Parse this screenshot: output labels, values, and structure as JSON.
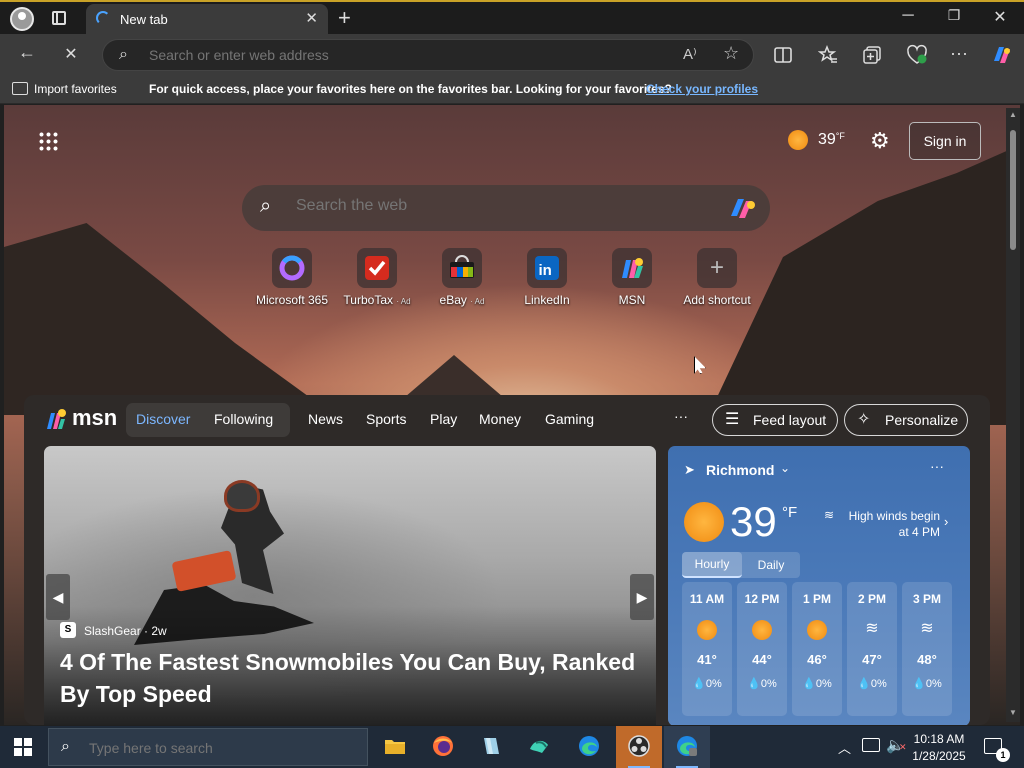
{
  "tabbar": {
    "tab_title": "New tab",
    "close_glyph": "✕",
    "new_tab_glyph": "+",
    "minimize_glyph": "─",
    "maximize_glyph": "❐",
    "close_window_glyph": "✕"
  },
  "navbar": {
    "back_glyph": "←",
    "stop_glyph": "✕",
    "address_placeholder": "Search or enter web address",
    "read_aloud_glyph": "A⁾",
    "favorite_glyph": "☆",
    "toolbar_icons": [
      "split-screen-icon",
      "favorites-icon",
      "collections-icon",
      "browser-essentials-icon",
      "more-icon",
      "copilot-icon"
    ]
  },
  "favbar": {
    "import_label": "Import favorites",
    "message": "For quick access, place your favorites here on the favorites bar. Looking for your favorites?",
    "link": "Check your profiles"
  },
  "newtab": {
    "weather_temp": "39",
    "weather_unit": "°F",
    "sign_in": "Sign in",
    "search_placeholder": "Search the web",
    "shortcuts": [
      {
        "label": "Microsoft 365",
        "ad": ""
      },
      {
        "label": "TurboTax",
        "ad": "· Ad"
      },
      {
        "label": "eBay",
        "ad": "· Ad"
      },
      {
        "label": "LinkedIn",
        "ad": ""
      },
      {
        "label": "MSN",
        "ad": ""
      },
      {
        "label": "Add shortcut",
        "ad": ""
      }
    ]
  },
  "msn": {
    "logo": "msn",
    "tabs": [
      "Discover",
      "Following"
    ],
    "nav": [
      "News",
      "Sports",
      "Play",
      "Money",
      "Gaming"
    ],
    "more": "···",
    "feed_layout": "Feed layout",
    "personalize": "Personalize"
  },
  "hero": {
    "source": "SlashGear",
    "age": "2w",
    "source_meta": "SlashGear · 2w",
    "headline": "4 Of The Fastest Snowmobiles You Can Buy, Ranked By Top Speed"
  },
  "weather": {
    "location": "Richmond",
    "temp": "39",
    "unit": "°F",
    "alert": "High winds begin at 4 PM",
    "tab_hourly": "Hourly",
    "tab_daily": "Daily",
    "hours": [
      {
        "time": "11 AM",
        "icon": "sun-icon",
        "temp": "41°",
        "precip": "💧0%"
      },
      {
        "time": "12 PM",
        "icon": "sun-icon",
        "temp": "44°",
        "precip": "💧0%"
      },
      {
        "time": "1 PM",
        "icon": "sun-icon",
        "temp": "46°",
        "precip": "💧0%"
      },
      {
        "time": "2 PM",
        "icon": "wind-icon",
        "temp": "47°",
        "precip": "💧0%"
      },
      {
        "time": "3 PM",
        "icon": "wind-icon",
        "temp": "48°",
        "precip": "💧0%"
      }
    ],
    "precip_text": [
      "0%",
      "0%",
      "0%",
      "0%",
      "0%"
    ]
  },
  "taskbar": {
    "search_placeholder": "Type here to search",
    "apps": [
      "file-explorer",
      "firefox",
      "notepad-app",
      "app-icon",
      "edge",
      "obs-studio",
      "edge-beta"
    ],
    "time": "10:18 AM",
    "date": "1/28/2025",
    "notification_count": "1"
  },
  "colors": {
    "accent_link": "#78b7ff",
    "weather_card": "#4a79b8",
    "taskbar": "#1f2a38"
  }
}
